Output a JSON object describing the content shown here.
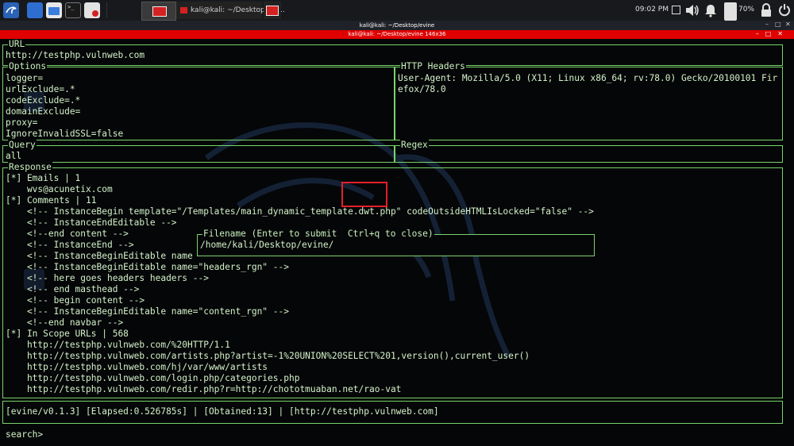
{
  "taskbar": {
    "active_task_label": "kali@kali: ~/Desktop/evi...",
    "clock": "09:02 PM",
    "battery": "70%",
    "workspace_terminal_glyph": ">_"
  },
  "window": {
    "title": "kali@kali: ~/Desktop/evine",
    "subtitle": "kali@kali: ~/Desktop/evine 146x36"
  },
  "panels": {
    "url": {
      "title": "URL",
      "value": "http://testphp.vulnweb.com"
    },
    "options": {
      "title": "Options",
      "lines": [
        "logger=",
        "urlExclude=.*",
        "codeExclude=.*",
        "domainExclude=",
        "proxy=",
        "IgnoreInvalidSSL=false"
      ]
    },
    "http_headers": {
      "title": "HTTP Headers",
      "lines": [
        "User-Agent: Mozilla/5.0 (X11; Linux x86_64; rv:78.0) Gecko/20100101 Fir",
        "efox/78.0"
      ]
    },
    "query": {
      "title": "Query",
      "value": "all"
    },
    "regex": {
      "title": "Regex",
      "value": ""
    },
    "response": {
      "title": "Response",
      "lines": [
        "[*] Emails | 1",
        "    wvs@acunetix.com",
        "[*] Comments | 11",
        "    <!-- InstanceBegin template=\"/Templates/main_dynamic_template.dwt.php\" codeOutsideHTMLIsLocked=\"false\" -->",
        "    <!-- InstanceEndEditable -->",
        "    <!--end content -->",
        "    <!-- InstanceEnd -->",
        "    <!-- InstanceBeginEditable name",
        "    <!-- InstanceBeginEditable name=\"headers_rgn\" -->",
        "    <!-- here goes headers headers -->",
        "    <!-- end masthead -->",
        "    <!-- begin content -->",
        "    <!-- InstanceBeginEditable name=\"content_rgn\" -->",
        "    <!--end navbar -->",
        "[*] In Scope URLs | 568",
        "    http://testphp.vulnweb.com/%20HTTP/1.1",
        "    http://testphp.vulnweb.com/artists.php?artist=-1%20UNION%20SELECT%201,version(),current_user()",
        "    http://testphp.vulnweb.com/hj/var/www/artists",
        "    http://testphp.vulnweb.com/login.php/categories.php",
        "    http://testphp.vulnweb.com/redir.php?r=http://chototmuaban.net/rao-vat"
      ]
    },
    "filename_dialog": {
      "title": "Filename (Enter to submit  Ctrl+q to close)",
      "value": "/home/kali/Desktop/evine/"
    },
    "status": {
      "text": "[evine/v0.1.3] [Elapsed:0.526785s] | [Obtained:13] | [http://testphp.vulnweb.com]"
    },
    "search": {
      "prompt": "search>"
    }
  },
  "colors": {
    "border": "#79d36b",
    "text": "#d4f2c9",
    "highlight": "#e3202a",
    "titlebar_red": "#e00000"
  }
}
